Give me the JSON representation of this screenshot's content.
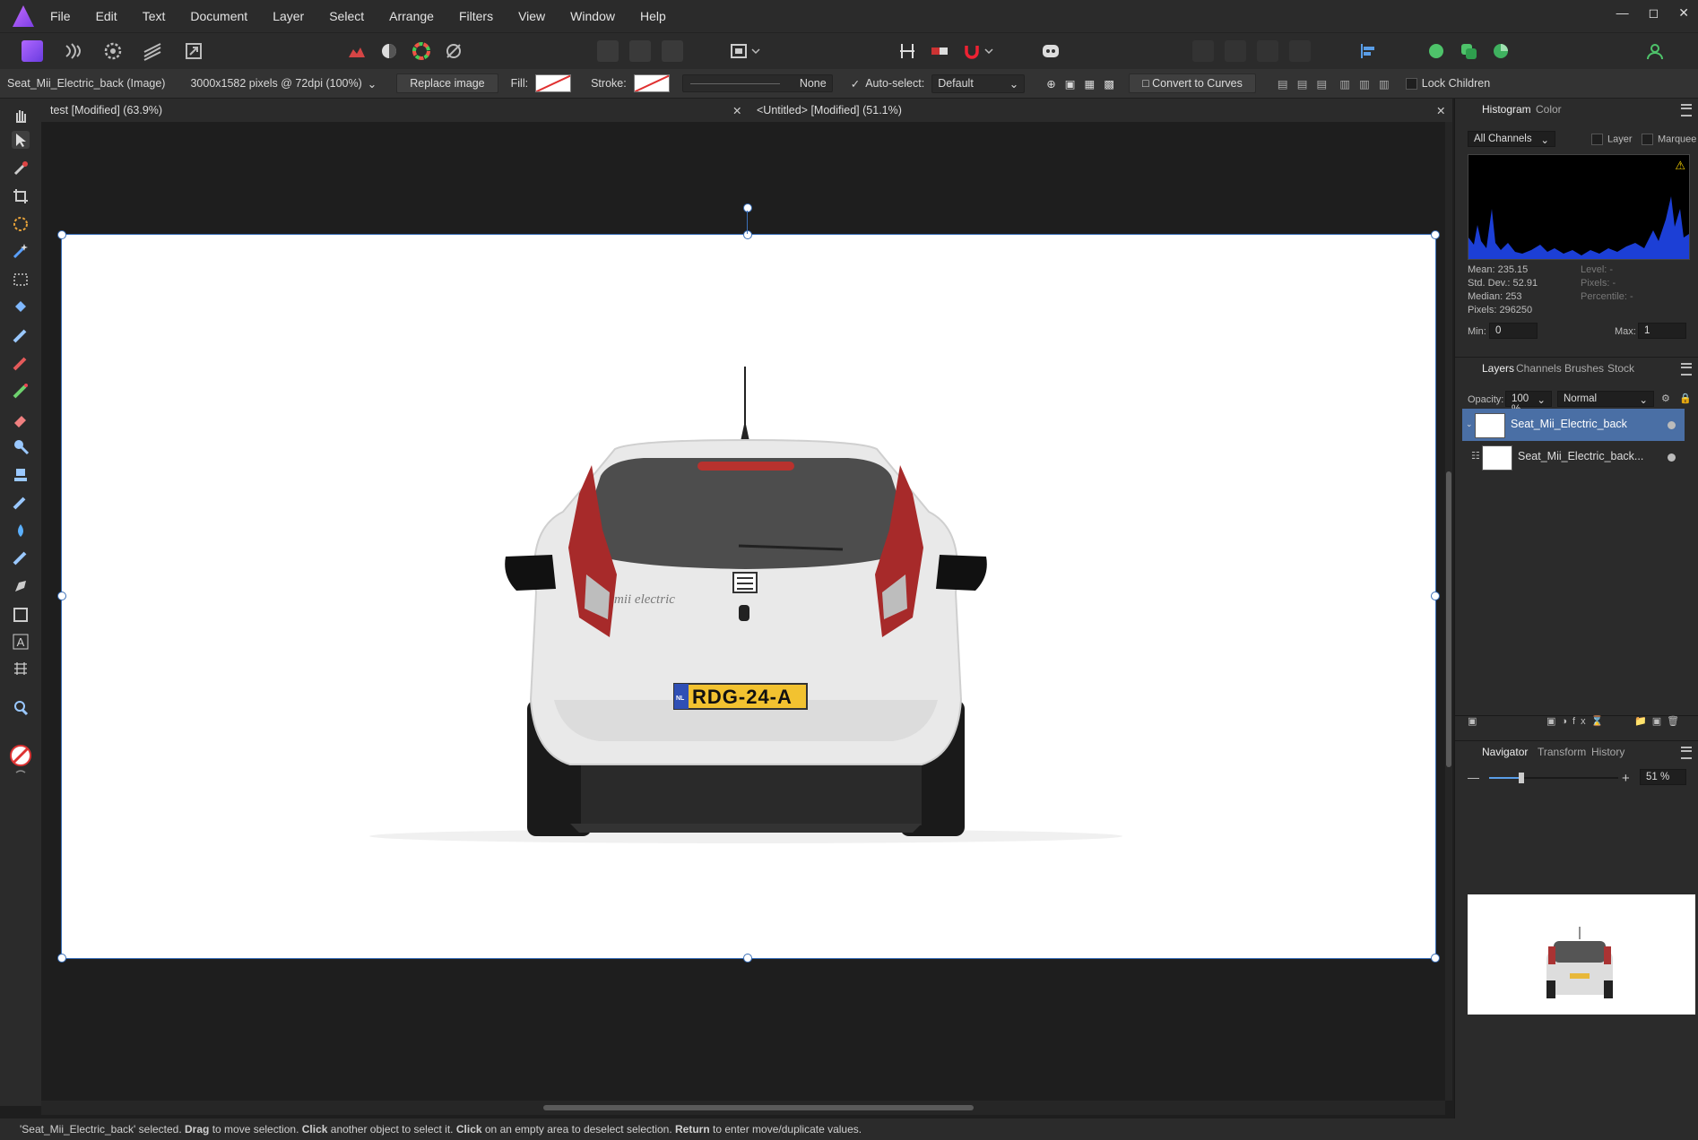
{
  "menu": {
    "items": [
      "File",
      "Edit",
      "Text",
      "Document",
      "Layer",
      "Select",
      "Arrange",
      "Filters",
      "View",
      "Window",
      "Help"
    ]
  },
  "context": {
    "object_name": "Seat_Mii_Electric_back (Image)",
    "image_info": "3000x1582 pixels @ 72dpi (100%)",
    "replace_image": "Replace image",
    "fill_label": "Fill:",
    "stroke_label": "Stroke:",
    "stroke_style": "None",
    "autoselect_label": "Auto-select:",
    "autoselect_value": "Default",
    "convert_to_curves": "Convert to Curves",
    "lock_children": "Lock Children"
  },
  "tabs": [
    {
      "label": "test [Modified] (63.9%)"
    },
    {
      "label": "<Untitled> [Modified] (51.1%)"
    }
  ],
  "histogram": {
    "tabs": [
      "Histogram",
      "Color"
    ],
    "channel": "All Channels",
    "layer_label": "Layer",
    "marquee_label": "Marquee",
    "mean": "Mean: 235.15",
    "std_dev": "Std. Dev.: 52.91",
    "median": "Median: 253",
    "pixels": "Pixels: 296250",
    "level": "Level: -",
    "pixels_r": "Pixels: -",
    "percentile": "Percentile: -",
    "min_label": "Min:",
    "min_value": "0",
    "max_label": "Max:",
    "max_value": "1"
  },
  "layers": {
    "tabs": [
      "Layers",
      "Channels",
      "Brushes",
      "Stock"
    ],
    "opacity_label": "Opacity:",
    "opacity_value": "100 %",
    "blend_mode": "Normal",
    "items": [
      {
        "name": "Seat_Mii_Electric_back",
        "selected": true
      },
      {
        "name": "Seat_Mii_Electric_back..."
      }
    ]
  },
  "navigator": {
    "tabs": [
      "Navigator",
      "Transform",
      "History"
    ],
    "zoom": "51 %",
    "zoom_fraction": 0.25
  },
  "car": {
    "plate": "RDG-24-A",
    "plate_country": "NL",
    "badge": "mii electric"
  },
  "status": {
    "p1": "'Seat_Mii_Electric_back' selected. ",
    "b1": "Drag",
    "p2": " to move selection. ",
    "b2": "Click",
    "p3": " another object to select it. ",
    "b3": "Click",
    "p4": " on an empty area to deselect selection. ",
    "b4": "Return",
    "p5": " to enter move/duplicate values."
  },
  "colors": {
    "accent": "#3a6fb8",
    "selected_layer": "#4a6fa5",
    "app_purple": "#8a4ff0"
  }
}
